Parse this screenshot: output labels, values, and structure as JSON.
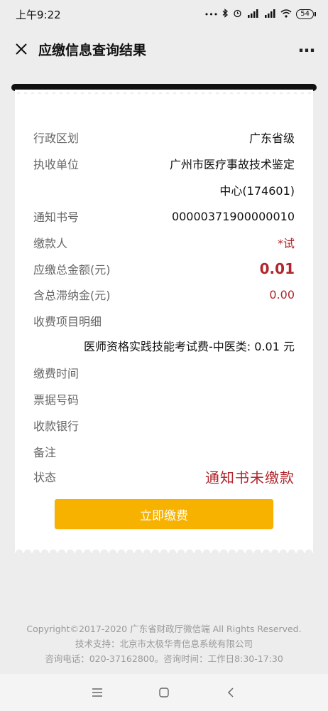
{
  "status_bar": {
    "time": "上午9:22",
    "dots": "•••",
    "battery": "54"
  },
  "header": {
    "title": "应缴信息查询结果"
  },
  "receipt": {
    "region": {
      "label": "行政区划",
      "value": "广东省级"
    },
    "collector": {
      "label": "执收单位",
      "value_line1": "广州市医疗事故技术鉴定",
      "value_line2": "中心(174601)"
    },
    "notice_no": {
      "label": "通知书号",
      "value": "00000371900000010"
    },
    "payer": {
      "label": "缴款人",
      "value": "*试"
    },
    "total": {
      "label": "应缴总金额(元)",
      "value": "0.01"
    },
    "late_fee": {
      "label": "含总滞纳金(元)",
      "value": "0.00"
    },
    "items": {
      "label": "收费项目明细",
      "detail": "医师资格实践技能考试费-中医类: 0.01 元"
    },
    "pay_time": {
      "label": "缴费时间",
      "value": ""
    },
    "invoice_no": {
      "label": "票据号码",
      "value": ""
    },
    "bank": {
      "label": "收款银行",
      "value": ""
    },
    "remark": {
      "label": "备注",
      "value": ""
    },
    "status": {
      "label": "状态",
      "value": "通知书未缴款"
    },
    "pay_button": "立即缴费"
  },
  "footer": {
    "line1": "Copyright©2017-2020 广东省财政厅微信端 All Rights Reserved.",
    "line2": "技术支持：北京市太极华青信息系统有限公司",
    "line3": "咨询电话：020-37162800。咨询时间：工作日8:30-17:30"
  },
  "colors": {
    "accent_red": "#b0262c",
    "pay_button": "#f7b200",
    "background": "#ededed"
  }
}
